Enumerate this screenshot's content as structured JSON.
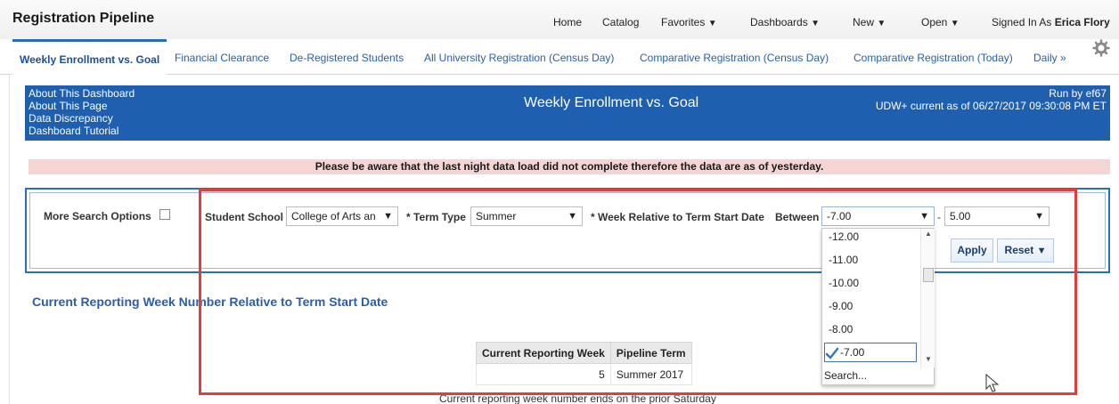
{
  "app_title": "Registration Pipeline",
  "nav": {
    "home": "Home",
    "catalog": "Catalog",
    "favorites": "Favorites",
    "dashboards": "Dashboards",
    "new": "New",
    "open": "Open",
    "signed_in_label": "Signed In As",
    "signed_in_user": "Erica Flory"
  },
  "tabs": [
    "Weekly Enrollment vs. Goal",
    "Financial Clearance",
    "De-Registered Students",
    "All University Registration (Census Day)",
    "Comparative Registration (Census Day)",
    "Comparative Registration (Today)",
    "Daily »"
  ],
  "banner": {
    "links": [
      "About This Dashboard",
      "About This Page",
      "Data Discrepancy",
      "Dashboard Tutorial"
    ],
    "title": "Weekly Enrollment vs. Goal",
    "run_by": "Run by ef67",
    "current_as_of": "UDW+ current as of 06/27/2017 09:30:08 PM ET"
  },
  "alert": "Please be aware that the last night data load did not complete therefore the data are as of yesterday.",
  "prompts": {
    "more_search_options": "More Search Options",
    "student_school_label": "Student School",
    "student_school_value": "College of Arts an",
    "term_type_label": "* Term Type",
    "term_type_value": "Summer",
    "week_label": "* Week Relative to Term Start Date",
    "between_label": "Between",
    "week_from": "-7.00",
    "dash": "-",
    "week_to": "5.00",
    "apply": "Apply",
    "reset": "Reset"
  },
  "dropdown": {
    "options": [
      "-12.00",
      "-11.00",
      "-10.00",
      "-9.00",
      "-8.00"
    ],
    "selected": "-7.00",
    "search": "Search..."
  },
  "section_title": "Current Reporting Week Number Relative to Term Start Date",
  "table": {
    "headers": [
      "Current Reporting Week",
      "Pipeline Term"
    ],
    "rows": [
      [
        "5",
        "Summer 2017"
      ]
    ]
  },
  "footnote": "Current reporting week number ends on the prior Saturday",
  "colors": {
    "banner_blue": "#1f5fb0",
    "alert_pink": "#f4d5d3",
    "highlight_red": "#e23c3c"
  }
}
